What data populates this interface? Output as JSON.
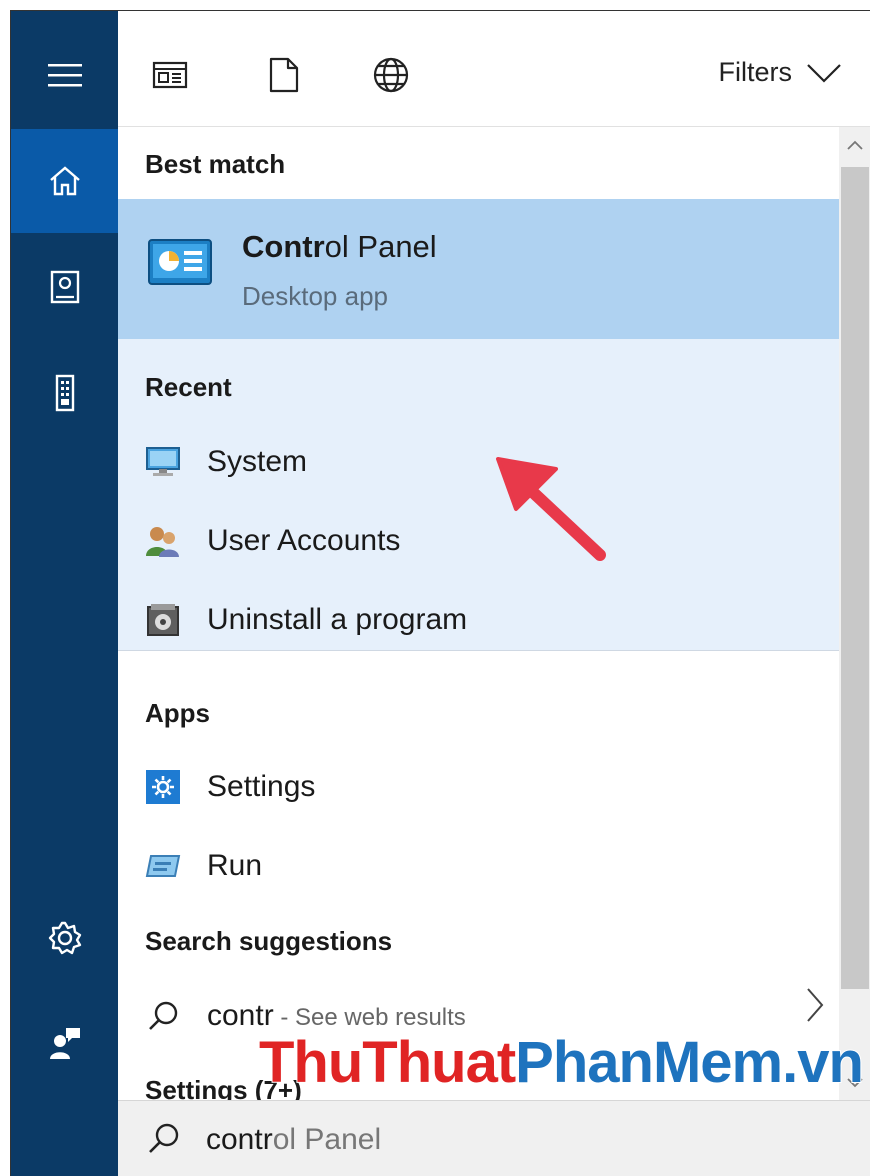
{
  "toolbar": {
    "filters_label": "Filters",
    "icons": [
      "news-icon",
      "document-icon",
      "globe-icon"
    ]
  },
  "rail": {
    "items": [
      "menu-icon",
      "home-icon",
      "notebook-icon",
      "device-icon",
      "settings-icon",
      "feedback-icon"
    ],
    "active": "home-icon"
  },
  "best_match": {
    "header": "Best match",
    "title_bold": "Contr",
    "title_rest": "ol Panel",
    "subtitle": "Desktop app"
  },
  "recent": {
    "header": "Recent",
    "items": [
      {
        "label": "System",
        "icon": "monitor-icon"
      },
      {
        "label": "User Accounts",
        "icon": "users-icon"
      },
      {
        "label": "Uninstall a program",
        "icon": "program-icon"
      }
    ]
  },
  "apps": {
    "header": "Apps",
    "items": [
      {
        "label": "Settings",
        "icon": "gear-app-icon"
      },
      {
        "label": "Run",
        "icon": "run-icon"
      }
    ]
  },
  "suggestions": {
    "header": "Search suggestions",
    "query": "contr",
    "hint": " - See web results"
  },
  "settings_section": {
    "header": "Settings (7+)"
  },
  "search": {
    "typed": "contr",
    "completion": "ol Panel"
  },
  "watermark": {
    "part1": "ThuThuat",
    "part2": "PhanMem.vn"
  },
  "colors": {
    "rail": "#0b3a66",
    "rail_active": "#0a5aa8",
    "highlight": "#afd2f1",
    "recent_bg": "#e6f0fb",
    "arrow": "#e8394a"
  }
}
